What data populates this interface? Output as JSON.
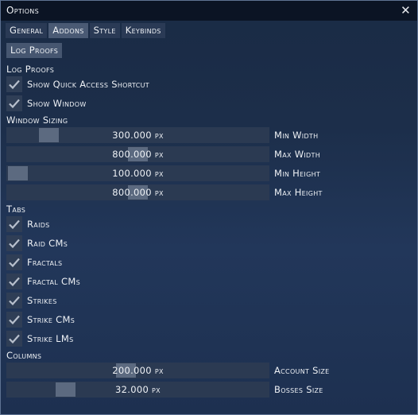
{
  "window": {
    "title": "Options",
    "close_glyph": "✕"
  },
  "tabs": [
    {
      "label": "General",
      "active": false
    },
    {
      "label": "Addons",
      "active": true
    },
    {
      "label": "Style",
      "active": false
    },
    {
      "label": "Keybinds",
      "active": false
    }
  ],
  "subtab": {
    "label": "Log Proofs"
  },
  "sections": {
    "log_proofs": "Log Proofs",
    "window_sizing": "Window Sizing",
    "tabs": "Tabs",
    "columns": "Columns"
  },
  "log_proofs_options": [
    {
      "label": "Show Quick Access Shortcut",
      "checked": true
    },
    {
      "label": "Show Window",
      "checked": true
    }
  ],
  "window_sizing": [
    {
      "value": "300.000 px",
      "label": "Min Width",
      "level": 0.13
    },
    {
      "value": "800.000 px",
      "label": "Max Width",
      "level": 0.5
    },
    {
      "value": "100.000 px",
      "label": "Min Height",
      "level": 0.0
    },
    {
      "value": "800.000 px",
      "label": "Max Height",
      "level": 0.5
    }
  ],
  "tab_options": [
    {
      "label": "Raids",
      "checked": true
    },
    {
      "label": "Raid CMs",
      "checked": true
    },
    {
      "label": "Fractals",
      "checked": true
    },
    {
      "label": "Fractal CMs",
      "checked": true
    },
    {
      "label": "Strikes",
      "checked": true
    },
    {
      "label": "Strike CMs",
      "checked": true
    },
    {
      "label": "Strike LMs",
      "checked": true
    }
  ],
  "columns": [
    {
      "value": "200.000 px",
      "label": "Account Size",
      "level": 0.45
    },
    {
      "value": "32.000 px",
      "label": "Bosses Size",
      "level": 0.2
    }
  ],
  "colors": {
    "check": "#b7bfcc",
    "accent": "#4a5a74"
  },
  "icons": {
    "check": "check-icon",
    "close": "close-icon"
  }
}
